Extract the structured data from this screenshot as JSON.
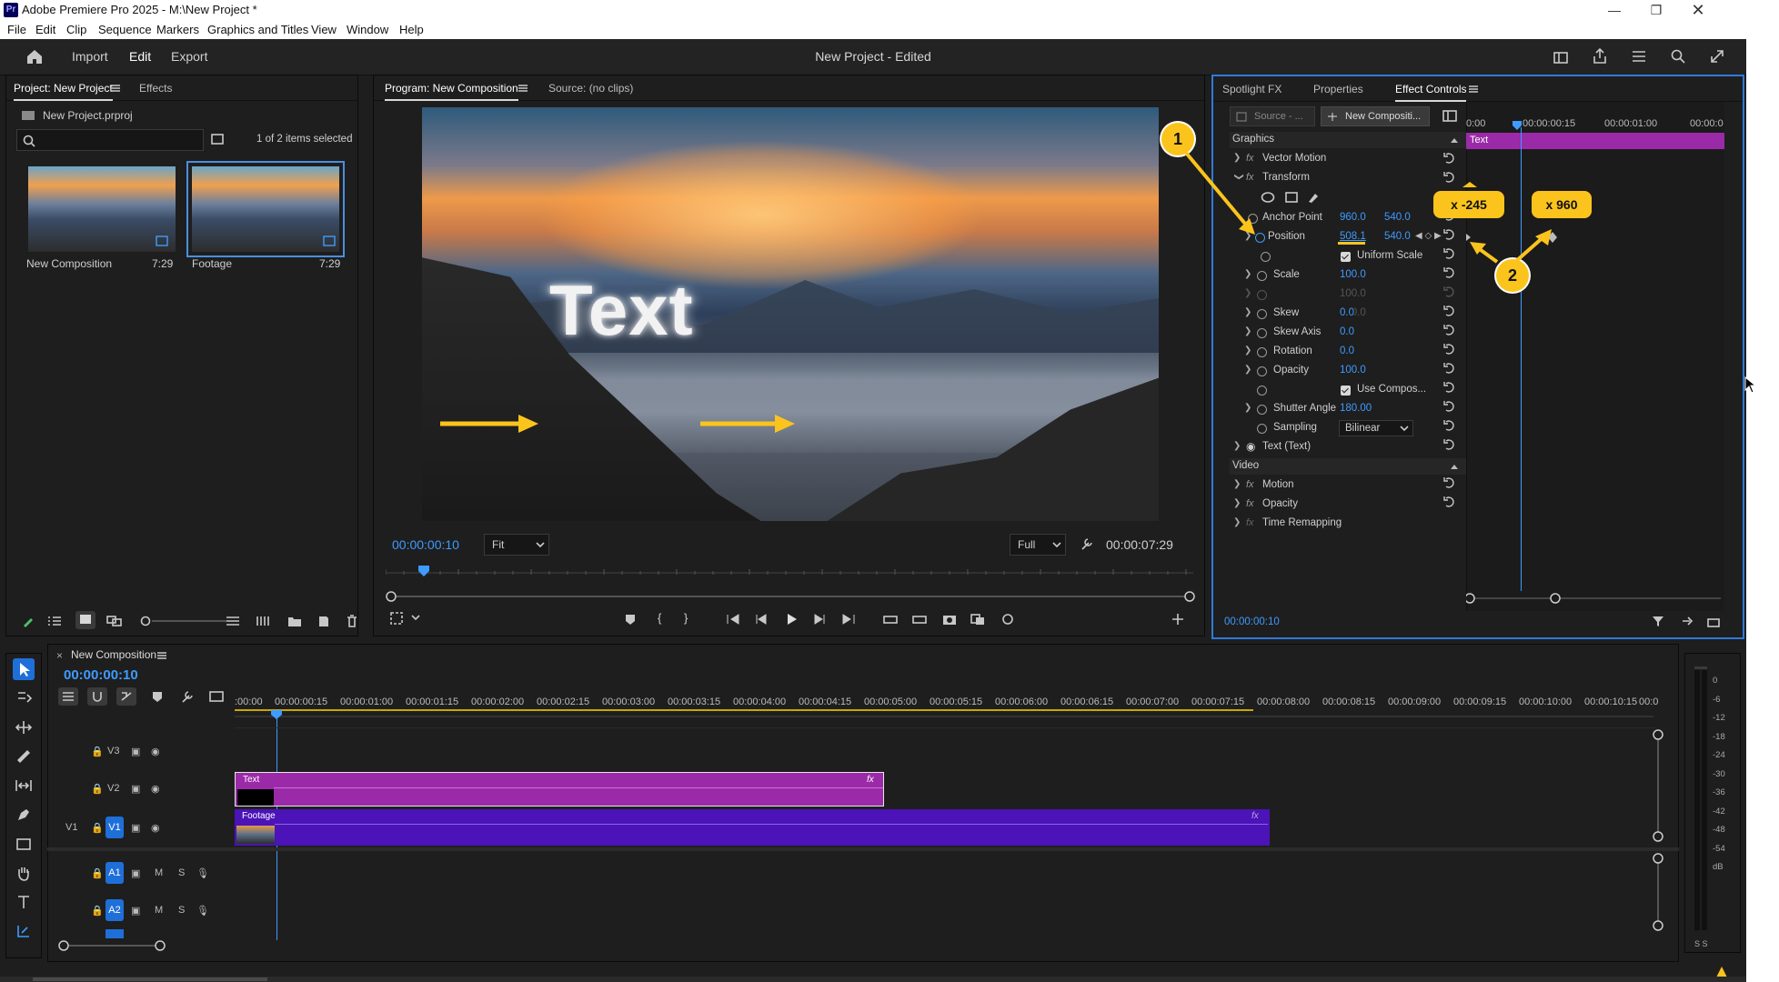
{
  "window": {
    "title": "Adobe Premiere Pro 2025 - M:\\New Project *",
    "app_badge": "Pr"
  },
  "menu": [
    "File",
    "Edit",
    "Clip",
    "Sequence",
    "Markers",
    "Graphics and Titles",
    "View",
    "Window",
    "Help"
  ],
  "header": {
    "import": "Import",
    "edit": "Edit",
    "export": "Export",
    "project_title": "New Project - Edited"
  },
  "project_panel": {
    "tabs": [
      "Project: New Project",
      "Effects"
    ],
    "file": "New Project.prproj",
    "selection": "1 of 2 items selected",
    "search_placeholder": "",
    "items": [
      {
        "name": "New Composition",
        "duration": "7:29"
      },
      {
        "name": "Footage",
        "duration": "7:29"
      }
    ]
  },
  "program_monitor": {
    "tabs": [
      "Program: New Composition",
      "Source: (no clips)"
    ],
    "overlay_text": "Text",
    "timecode": "00:00:00:10",
    "fit": "Fit",
    "quality": "Full",
    "duration": "00:00:07:29"
  },
  "effect_controls": {
    "tabs": [
      "Spotlight FX",
      "Properties",
      "Effect Controls"
    ],
    "source_btn": "Source - ...",
    "comp_btn": "New Compositi...",
    "ruler": [
      "0:00",
      "00:00:00:15",
      "00:00:01:00",
      "00:00:0"
    ],
    "clip_label": "Text",
    "section_graphics": "Graphics",
    "section_video": "Video",
    "rows": {
      "vector_motion": "Vector Motion",
      "transform": "Transform",
      "anchor_point": "Anchor Point",
      "anchor_x": "960.0",
      "anchor_y": "540.0",
      "position": "Position",
      "pos_x": "508.1",
      "pos_y": "540.0",
      "uniform_scale": "Uniform Scale",
      "scale": "Scale",
      "scale_val": "100.0",
      "scale_dim": "100.0",
      "scale_dim2": "100.0",
      "skew": "Skew",
      "skew_val": "0.0",
      "skew_axis": "Skew Axis",
      "skew_axis_val": "0.0",
      "rotation": "Rotation",
      "rotation_val": "0.0",
      "opacity": "Opacity",
      "opacity_val": "100.0",
      "use_composition": "Use Compos...",
      "shutter_angle": "Shutter Angle",
      "shutter_val": "180.00",
      "sampling": "Sampling",
      "sampling_val": "Bilinear",
      "text_layer": "Text (Text)",
      "motion": "Motion",
      "video_opacity": "Opacity",
      "time_remap": "Time Remapping"
    },
    "timecode": "00:00:00:10"
  },
  "callouts": {
    "one": "1",
    "two": "2",
    "x_start": "x -245",
    "x_end": "x 960"
  },
  "timeline": {
    "sequence": "New Composition",
    "timecode": "00:00:00:10",
    "ruler": [
      ":00:00",
      "00:00:00:15",
      "00:00:01:00",
      "00:00:01:15",
      "00:00:02:00",
      "00:00:02:15",
      "00:00:03:00",
      "00:00:03:15",
      "00:00:04:00",
      "00:00:04:15",
      "00:00:05:00",
      "00:00:05:15",
      "00:00:06:00",
      "00:00:06:15",
      "00:00:07:00",
      "00:00:07:15",
      "00:00:08:00",
      "00:00:08:15",
      "00:00:09:00",
      "00:00:09:15",
      "00:00:10:00",
      "00:00:10:15",
      "00:0"
    ],
    "tracks": {
      "v3": "V3",
      "v2": "V2",
      "v1": "V1",
      "v1src": "V1",
      "a1": "A1",
      "a2": "A2",
      "m": "M",
      "s": "S"
    },
    "clips": {
      "text": "Text",
      "footage": "Footage",
      "fx": "fx"
    }
  },
  "meter": {
    "labels": [
      "0",
      "-6",
      "-12",
      "-18",
      "-24",
      "-30",
      "-36",
      "-42",
      "-48",
      "-54",
      "dB"
    ],
    "ss": "S S"
  },
  "colors": {
    "accent": "#3e9bff",
    "clip_text": "#9b2aa8",
    "clip_footage": "#4b13b8",
    "callout": "#fbc41c"
  }
}
